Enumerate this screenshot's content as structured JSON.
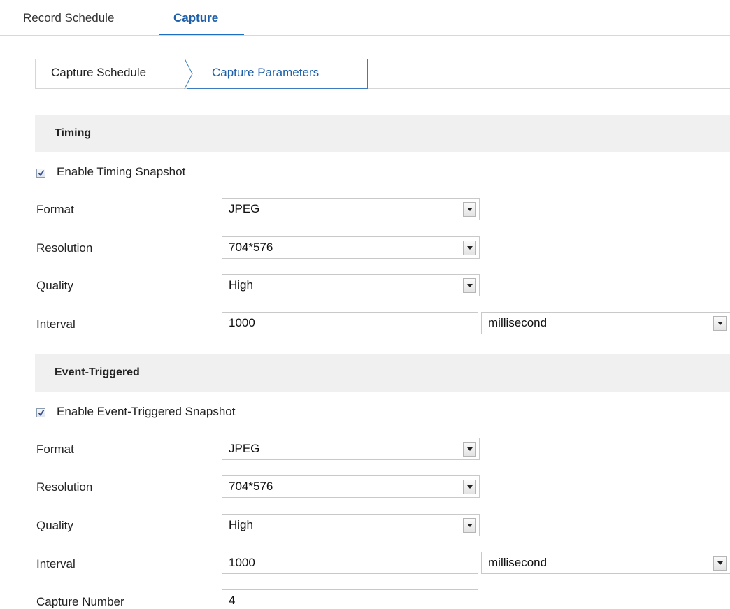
{
  "top_tabs": {
    "record_schedule": "Record Schedule",
    "capture": "Capture"
  },
  "sub_tabs": {
    "capture_schedule": "Capture Schedule",
    "capture_parameters": "Capture Parameters"
  },
  "timing": {
    "heading": "Timing",
    "enable_label": "Enable Timing Snapshot",
    "enabled": true,
    "format_label": "Format",
    "format_value": "JPEG",
    "resolution_label": "Resolution",
    "resolution_value": "704*576",
    "quality_label": "Quality",
    "quality_value": "High",
    "interval_label": "Interval",
    "interval_value": "1000",
    "interval_unit": "millisecond"
  },
  "event": {
    "heading": "Event-Triggered",
    "enable_label": "Enable Event-Triggered Snapshot",
    "enabled": true,
    "format_label": "Format",
    "format_value": "JPEG",
    "resolution_label": "Resolution",
    "resolution_value": "704*576",
    "quality_label": "Quality",
    "quality_value": "High",
    "interval_label": "Interval",
    "interval_value": "1000",
    "interval_unit": "millisecond",
    "capture_number_label": "Capture Number",
    "capture_number_value": "4"
  },
  "colors": {
    "accent": "#1d6fc2",
    "section_bg": "#f0f0f0"
  }
}
